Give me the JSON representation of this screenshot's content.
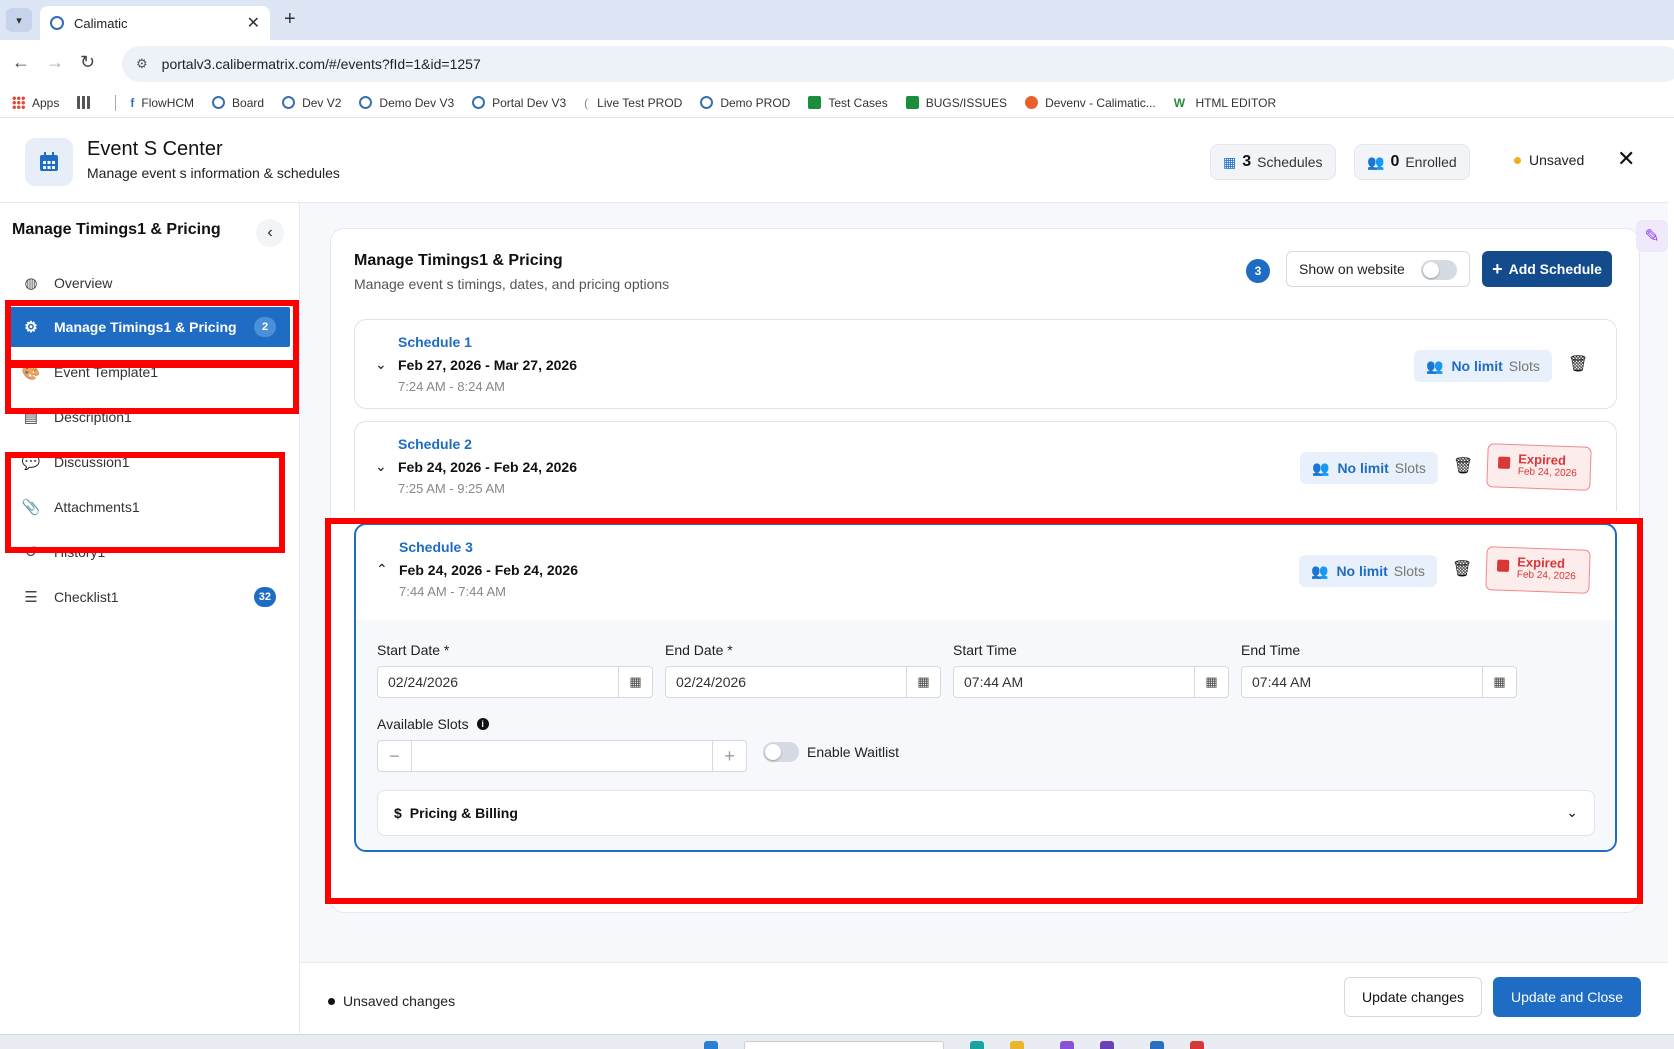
{
  "browser": {
    "tab_title": "Calimatic",
    "url": "portalv3.calibermatrix.com/#/events?fId=1&id=1257",
    "bookmarks": [
      {
        "label": "Apps",
        "icon": "apps-grid-icon"
      },
      {
        "label": "",
        "icon": "grid-icon"
      },
      {
        "label": "FlowHCM",
        "icon": "flowhcm-icon"
      },
      {
        "label": "Board",
        "icon": "calimatic-icon"
      },
      {
        "label": "Dev V2",
        "icon": "calimatic-icon"
      },
      {
        "label": "Demo Dev V3",
        "icon": "calimatic-icon"
      },
      {
        "label": "Portal Dev V3",
        "icon": "calimatic-icon"
      },
      {
        "label": "Live Test PROD",
        "icon": "bookmark-icon"
      },
      {
        "label": "Demo PROD",
        "icon": "calimatic-icon"
      },
      {
        "label": "Test Cases",
        "icon": "sheets-icon"
      },
      {
        "label": "BUGS/ISSUES",
        "icon": "sheets-icon"
      },
      {
        "label": "Devenv - Calimatic...",
        "icon": "devenv-icon"
      },
      {
        "label": "HTML EDITOR",
        "icon": "html-editor-icon"
      }
    ]
  },
  "header": {
    "title": "Event S Center",
    "subtitle": "Manage event s information & schedules",
    "schedules_count": "3",
    "schedules_label": "Schedules",
    "enrolled_count": "0",
    "enrolled_label": "Enrolled",
    "status": "Unsaved",
    "status_color": "#f0ad1f"
  },
  "sidebar": {
    "title": "Manage Timings1 & Pricing",
    "items": [
      {
        "label": "Overview",
        "icon": "palette-globe-icon",
        "badge": ""
      },
      {
        "label": "Manage Timings1 & Pricing",
        "icon": "gear-icon",
        "badge": "2",
        "active": true
      },
      {
        "label": "Event Template1",
        "icon": "palette-icon",
        "badge": ""
      },
      {
        "label": "Description1",
        "icon": "document-icon",
        "badge": ""
      },
      {
        "label": "Discussion1",
        "icon": "comments-icon",
        "badge": ""
      },
      {
        "label": "Attachments1",
        "icon": "paperclip-icon",
        "badge": ""
      },
      {
        "label": "History1",
        "icon": "history-icon",
        "badge": ""
      },
      {
        "label": "Checklist1",
        "icon": "checklist-icon",
        "badge": "32"
      }
    ]
  },
  "main": {
    "title": "Manage Timings1 & Pricing",
    "subtitle": "Manage event s timings, dates, and pricing options",
    "count_badge": "3",
    "show_on_website_label": "Show on website",
    "show_on_website": false,
    "add_schedule_label": "Add Schedule",
    "schedules": [
      {
        "name": "Schedule 1",
        "dates": "Feb 27, 2026 - Mar 27, 2026",
        "times": "7:24 AM - 8:24 AM",
        "slots_value": "No limit",
        "slots_label": "Slots",
        "expired": false
      },
      {
        "name": "Schedule 2",
        "dates": "Feb 24, 2026 - Feb 24, 2026",
        "times": "7:25 AM - 9:25 AM",
        "slots_value": "No limit",
        "slots_label": "Slots",
        "expired": true,
        "expired_label": "Expired",
        "expired_date": "Feb 24, 2026"
      },
      {
        "name": "Schedule 3",
        "dates": "Feb 24, 2026 - Feb 24, 2026",
        "times": "7:44 AM - 7:44 AM",
        "slots_value": "No limit",
        "slots_label": "Slots",
        "expired": true,
        "expired_label": "Expired",
        "expired_date": "Feb 24, 2026",
        "expanded": true
      }
    ],
    "form": {
      "start_date_label": "Start Date *",
      "start_date": "02/24/2026",
      "end_date_label": "End Date *",
      "end_date": "02/24/2026",
      "start_time_label": "Start Time",
      "start_time": "07:44 AM",
      "end_time_label": "End Time",
      "end_time": "07:44 AM",
      "available_slots_label": "Available Slots",
      "available_slots": "",
      "waitlist_label": "Enable Waitlist",
      "waitlist_enabled": false,
      "pricing_label": "Pricing & Billing"
    }
  },
  "footer": {
    "unsaved_text": "Unsaved changes",
    "update_label": "Update changes",
    "update_close_label": "Update and Close"
  },
  "colors": {
    "primary": "#1e6cc4",
    "dark_primary": "#144b8c",
    "annotation": "#ff0000",
    "expired": "#d93636"
  }
}
